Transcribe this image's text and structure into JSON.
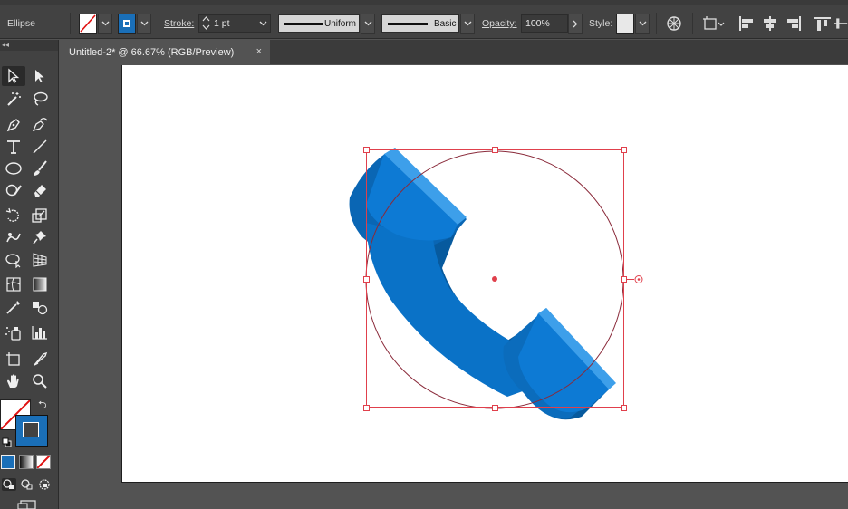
{
  "control_bar": {
    "selection_type": "Ellipse",
    "stroke_label": "Stroke:",
    "stroke_weight": "1 pt",
    "profile_label": "Uniform",
    "brush_label": "Basic",
    "opacity_label": "Opacity:",
    "opacity_value": "100%",
    "style_label": "Style:"
  },
  "document_tab": {
    "title": "Untitled-2* @ 66.67% (RGB/Preview)",
    "close_glyph": "×"
  },
  "toolbox": {
    "collapse_glyph": "◂◂",
    "tools": [
      "selection",
      "direct-selection",
      "magic-wand",
      "lasso",
      "pen",
      "curvature",
      "type",
      "line-segment",
      "ellipse",
      "paintbrush",
      "shaper",
      "eraser",
      "rotate",
      "scale",
      "warp",
      "free-transform",
      "shape-builder",
      "perspective-grid",
      "mesh",
      "gradient",
      "eyedropper",
      "blend",
      "symbol-sprayer",
      "column-graph",
      "artboard",
      "slice",
      "hand",
      "zoom"
    ],
    "swap_glyph": "⮌"
  },
  "artwork": {
    "object": "phone-handset",
    "handset_color": "#0a72c7",
    "handset_light": "#1f8be0",
    "handset_dark": "#075a9e",
    "selection_color": "#e0404c",
    "ellipse_stroke_color": "#8a2a3a"
  },
  "colors": {
    "fill": "none",
    "stroke": "#1a6fb8"
  }
}
